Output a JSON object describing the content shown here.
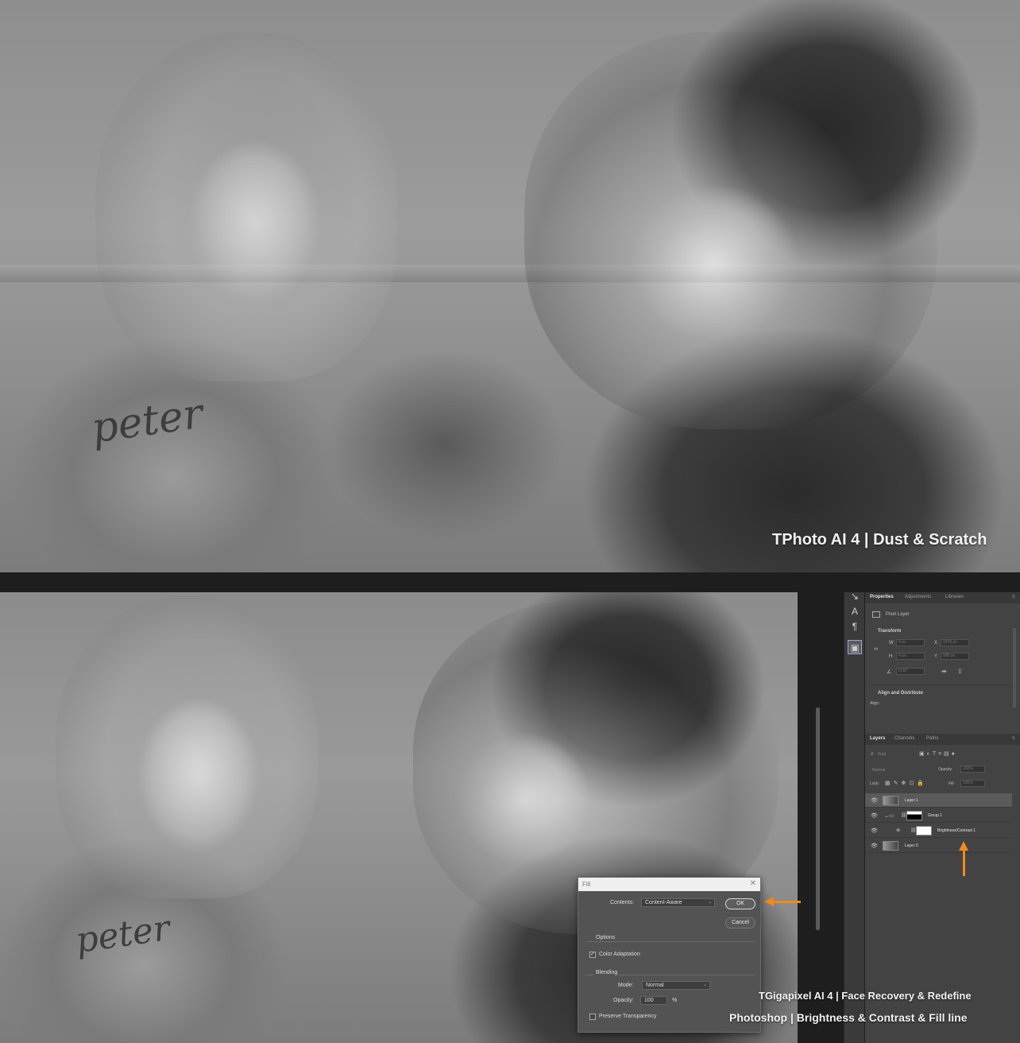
{
  "captions": {
    "top": "TPhoto AI 4 | Dust & Scratch",
    "bottom_line1": "TGigapixel AI 4 | Face Recovery & Redefine",
    "bottom_line2": "Photoshop | Brightness & Contrast & Fill line"
  },
  "photo": {
    "handwriting": "peter"
  },
  "properties_panel": {
    "tabs": [
      "Properties",
      "Adjustments",
      "Libraries"
    ],
    "layer_type": "Pixel Layer",
    "transform_heading": "Transform",
    "fields": {
      "w": "W",
      "w_value": "4 px",
      "x": "X",
      "x_value": "1576 px",
      "h": "H",
      "h_value": "4 px",
      "y": "Y",
      "y_value": "588 px",
      "angle_value": "0.00°"
    },
    "align_heading": "Align and Distribute",
    "align_label": "Align:"
  },
  "layers_panel": {
    "tabs": [
      "Layers",
      "Channels",
      "Paths"
    ],
    "search_placeholder": "Kind",
    "blend_mode": "Normal",
    "opacity_label": "Opacity:",
    "opacity_value": "100%",
    "lock_label": "Lock:",
    "fill_label": "Fill:",
    "fill_value": "100%",
    "layers": [
      {
        "name": "Layer 1",
        "selected": true
      },
      {
        "name": "Group 1",
        "selected": false
      },
      {
        "name": "Brightness/Contrast 1",
        "selected": false
      },
      {
        "name": "Layer 0",
        "selected": false
      }
    ]
  },
  "fill_dialog": {
    "title": "Fill",
    "contents_label": "Contents:",
    "contents_value": "Content-Aware",
    "ok_label": "OK",
    "cancel_label": "Cancel",
    "options_heading": "Options",
    "color_adaptation_label": "Color Adaptation",
    "color_adaptation_checked": true,
    "blending_heading": "Blending",
    "mode_label": "Mode:",
    "mode_value": "Normal",
    "opacity_label": "Opacity:",
    "opacity_value": "100",
    "opacity_unit": "%",
    "preserve_transparency_label": "Preserve Transparency",
    "preserve_transparency_checked": false
  },
  "colors": {
    "accent_arrow": "#f08a1c",
    "panel_bg": "#434343",
    "dialog_bg": "#535353"
  },
  "icons": [
    "eye-icon",
    "search-icon",
    "lock-icon",
    "link-icon",
    "folder-icon",
    "adjustment-icon",
    "close-icon",
    "chevron-down-icon",
    "arrow-left-icon",
    "arrow-up-icon"
  ]
}
